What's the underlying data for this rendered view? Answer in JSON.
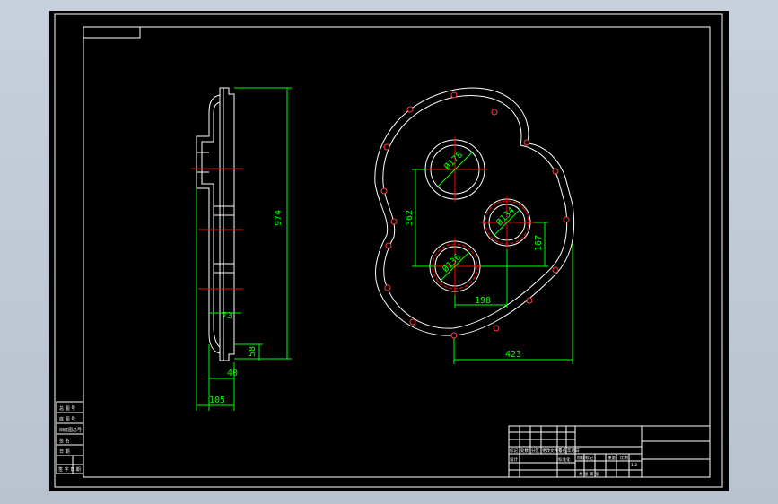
{
  "colors": {
    "background": "#000000",
    "outline": "#ffffff",
    "dimension": "#00ff00",
    "centerline": "#ff0000",
    "bolt": "#ff3b3b"
  },
  "dimensions": {
    "side_height": "974",
    "side_offset_top": "73",
    "side_step": "58",
    "side_width_small": "40",
    "side_width_total": "105",
    "center_distance_vertical": "362",
    "center_distance_small": "167",
    "horizontal_offset": "198",
    "overall_width": "423",
    "bore_large": "Ø178",
    "bore_small": "Ø134",
    "bore_medium": "Ø136"
  },
  "left_table": {
    "rows": [
      "总  图  号",
      "底  图  号",
      "旧底图总号",
      "签    名",
      "日    期",
      "签 字 日 期"
    ]
  },
  "title_block": {
    "row_labels": [
      "标记",
      "处数",
      "分区",
      "更改文件号",
      "签名",
      "年月日"
    ],
    "stage_label": "阶段标记",
    "weight_label": "重量",
    "scale_label": "比例",
    "scale_value": "1:2",
    "sheet_label": "共  张  第  张",
    "design_label": "设计",
    "standard_label": "标准化"
  }
}
